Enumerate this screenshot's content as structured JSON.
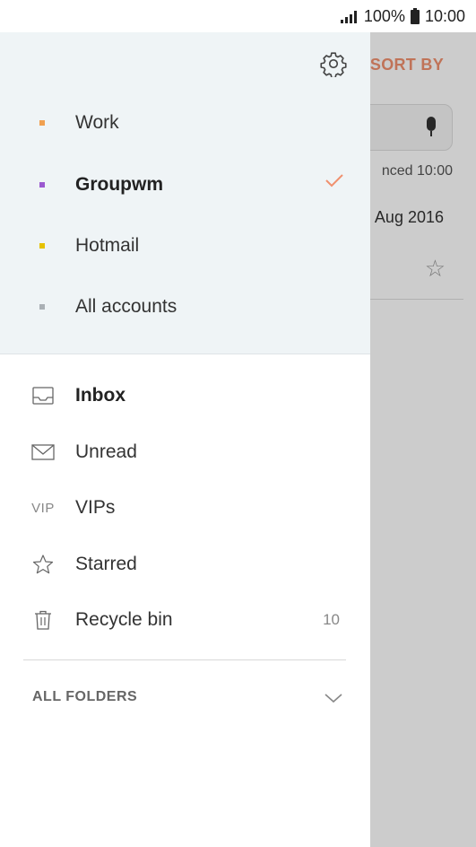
{
  "status_bar": {
    "battery": "100%",
    "time": "10:00"
  },
  "background_app": {
    "sort_label": "SORT BY",
    "meta": "nced  10:00",
    "date": "Aug 2016"
  },
  "drawer": {
    "accounts": [
      {
        "label": "Work",
        "color": "#f0a050",
        "selected": false
      },
      {
        "label": "Groupwm",
        "color": "#9b59d0",
        "selected": true
      },
      {
        "label": "Hotmail",
        "color": "#e6c200",
        "selected": false
      },
      {
        "label": "All accounts",
        "color": "#aab0b5",
        "selected": false
      }
    ],
    "folders": [
      {
        "label": "Inbox",
        "icon": "inbox-icon",
        "bold": true,
        "count": ""
      },
      {
        "label": "Unread",
        "icon": "envelope-icon",
        "bold": false,
        "count": ""
      },
      {
        "label": "VIPs",
        "icon": "vip-icon",
        "icon_text": "VIP",
        "bold": false,
        "count": ""
      },
      {
        "label": "Starred",
        "icon": "star-icon",
        "bold": false,
        "count": ""
      },
      {
        "label": "Recycle bin",
        "icon": "trash-icon",
        "bold": false,
        "count": "10"
      }
    ],
    "all_folders_label": "ALL FOLDERS"
  },
  "colors": {
    "accent": "#f0906e",
    "drawer_header_bg": "#eff4f6"
  }
}
